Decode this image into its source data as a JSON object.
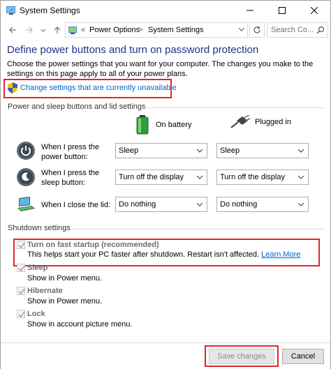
{
  "window": {
    "title": "System Settings",
    "app_icon": "power-options-icon"
  },
  "nav": {
    "breadcrumb_prefix": "«",
    "crumb1": "Power Options",
    "separator": ">",
    "crumb2": "System Settings",
    "search_placeholder": "Search Co..."
  },
  "page": {
    "heading": "Define power buttons and turn on password protection",
    "intro": "Choose the power settings that you want for your computer. The changes you make to the settings on this page apply to all of your power plans.",
    "change_link": "Change settings that are currently unavailable"
  },
  "power_group": {
    "label": "Power and sleep buttons and lid settings",
    "col_battery": "On battery",
    "col_plugged": "Plugged in",
    "rows": [
      {
        "label_line1": "When I press the",
        "label_line2": "power button:",
        "battery": "Sleep",
        "plugged": "Sleep"
      },
      {
        "label_line1": "When I press the",
        "label_line2": "sleep button:",
        "battery": "Turn off the display",
        "plugged": "Turn off the display"
      },
      {
        "label_line1": "When I close the lid:",
        "label_line2": "",
        "battery": "Do nothing",
        "plugged": "Do nothing"
      }
    ]
  },
  "shutdown_group": {
    "label": "Shutdown settings",
    "options": [
      {
        "title": "Turn on fast startup (recommended)",
        "desc": "This helps start your PC faster after shutdown. Restart isn't affected.",
        "link": "Learn More",
        "checked": true
      },
      {
        "title": "Sleep",
        "desc": "Show in Power menu.",
        "checked": true
      },
      {
        "title": "Hibernate",
        "desc": "Show in Power menu.",
        "checked": true
      },
      {
        "title": "Lock",
        "desc": "Show in account picture menu.",
        "checked": true
      }
    ]
  },
  "footer": {
    "save": "Save changes",
    "cancel": "Cancel"
  },
  "colors": {
    "heading": "#1e3287",
    "link": "#0066cc",
    "highlight": "#e0262d"
  }
}
